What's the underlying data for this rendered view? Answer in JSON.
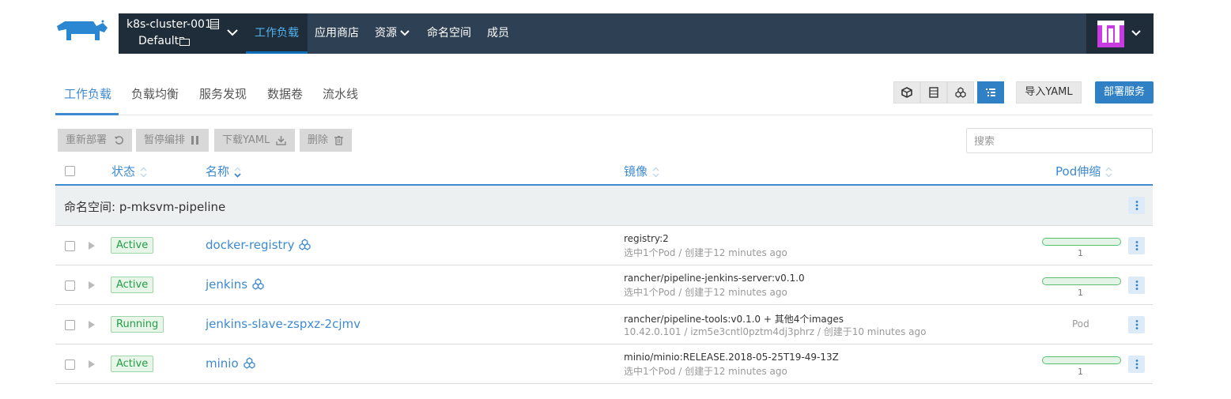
{
  "header": {
    "cluster_name": "k8s-cluster-001",
    "project_name": "Default",
    "nav": [
      {
        "label": "工作负载",
        "active": true
      },
      {
        "label": "应用商店",
        "active": false
      },
      {
        "label": "资源",
        "active": false
      },
      {
        "label": "命名空间",
        "active": false
      },
      {
        "label": "成员",
        "active": false
      }
    ],
    "icons": [
      "rancher-logo-icon",
      "cluster-icon",
      "project-icon",
      "chevron-down-icon",
      "avatar"
    ]
  },
  "subnav": {
    "tabs": [
      {
        "label": "工作负载",
        "active": true
      },
      {
        "label": "负载均衡",
        "active": false
      },
      {
        "label": "服务发现",
        "active": false
      },
      {
        "label": "数据卷",
        "active": false
      },
      {
        "label": "流水线",
        "active": false
      }
    ],
    "view_modes": [
      "cube-icon",
      "server-icon",
      "workload-cluster-icon",
      "list-icon"
    ],
    "import_label": "导入YAML",
    "deploy_label": "部署服务"
  },
  "bulk_actions": {
    "redeploy": "重新部署",
    "pause": "暂停编排",
    "download": "下载YAML",
    "delete": "删除"
  },
  "search": {
    "placeholder": "搜索",
    "value": ""
  },
  "table": {
    "headers": {
      "state": "状态",
      "name": "名称",
      "image": "镜像",
      "scale": "Pod伸缩"
    },
    "group_label": "命名空间: p-mksvm-pipeline",
    "rows": [
      {
        "state": "Active",
        "name": "docker-registry",
        "image": "registry:2",
        "detail": "选中1个Pod / 创建于12 minutes ago",
        "scale": "1",
        "has_icon": true
      },
      {
        "state": "Active",
        "name": "jenkins",
        "image": "rancher/pipeline-jenkins-server:v0.1.0",
        "detail": "选中1个Pod / 创建于12 minutes ago",
        "scale": "1",
        "has_icon": true
      },
      {
        "state": "Running",
        "name": "jenkins-slave-zspxz-2cjmv",
        "image": "rancher/pipeline-tools:v0.1.0 + 其他4个images",
        "detail": "10.42.0.101 / izm5e3cntl0pztm4dj3phrz / 创建于10 minutes ago",
        "scale": "Pod",
        "has_icon": false
      },
      {
        "state": "Active",
        "name": "minio",
        "image": "minio/minio:RELEASE.2018-05-25T19-49-13Z",
        "detail": "选中1个Pod / 创建于12 minutes ago",
        "scale": "1",
        "has_icon": true
      }
    ]
  },
  "colors": {
    "accent": "#3d8ad1",
    "nav_bg": "#2e4053",
    "nav_dark": "#1f2d3a",
    "active_green": "#239e46"
  }
}
